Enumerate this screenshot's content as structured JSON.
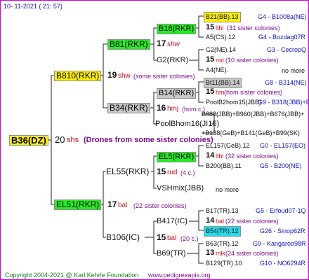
{
  "header": {
    "date": "10- 11-2021 ( 21: 57)"
  },
  "footer": {
    "copyright": "Copyright 2004-2021 @ Karl Kehrle Foundation",
    "website": "www.pedigreeapis.org"
  },
  "root": {
    "label": "B36(DZ)",
    "gen": "20",
    "breeder": "shs",
    "note": "(Drones from some sister colonies)"
  },
  "gen1": {
    "top": {
      "label": "B810(RKR)",
      "gen": "19",
      "breeder": "shw",
      "note": "(some sister colonies)"
    },
    "bottom": {
      "label": "EL51(RKR)",
      "gen": "17",
      "breeder": "bal",
      "note": "(22 sister colonies)"
    }
  },
  "gen2": {
    "b81": {
      "label": "B81(RKR)",
      "gen": "17",
      "breeder": "shw"
    },
    "b34": {
      "label": "B34(RKR)",
      "gen": "16",
      "breeder": "hmj",
      "note": "(hom c.)"
    },
    "el55": {
      "label": "EL55(RKR)",
      "gen": "15",
      "breeder": "rud",
      "note": "(4 c.)"
    },
    "b106": {
      "label": "B106(IC)",
      "gen": "15",
      "breeder": "bal",
      "note": "(20 c.)"
    }
  },
  "gen3": {
    "b18": {
      "label": "B18(RKR)"
    },
    "g2": {
      "label": "G2(RKR)"
    },
    "b14": {
      "label": "B14(RKR)"
    },
    "poolbhom": {
      "label": "PoolBhom16(JI15)"
    },
    "el5": {
      "label": "EL5(RKR)"
    },
    "vshmix": {
      "label": "VSHmix(JBB)",
      "more": "no more"
    },
    "b417": {
      "label": "B417(IC)"
    },
    "b69": {
      "label": "B69(TR)"
    }
  },
  "gen4": [
    {
      "key": "b21",
      "label": "B21(BB).13",
      "id": "G4 - B1008a(NE)"
    },
    {
      "key": "b21_note",
      "gen": "15",
      "breeder": "lthl",
      "note": "(31 sister colonies)"
    },
    {
      "key": "a5",
      "label": "A5(CS).12",
      "id": "G4 - Bozdag07R"
    },
    {
      "key": "g2ne",
      "label": "G2(NE).14",
      "id": "G3 - CecropQ"
    },
    {
      "key": "g2ne_note",
      "gen": "15",
      "breeder": "nst",
      "note": "(10 sister colonies)"
    },
    {
      "key": "a4",
      "label": "A4(NE).",
      "id": "no more"
    },
    {
      "key": "bt11",
      "label": "Bt11(BB).14",
      "id": "G8 - B314(NE)"
    },
    {
      "key": "bt11_note",
      "gen": "15",
      "breeder": "hm",
      "note": "(hom sister colonies)"
    },
    {
      "key": "poolb2",
      "label": "PoolB2hom15(JBB)",
      "id": "G9 - B318(JBB)+B88(JBB)+"
    },
    {
      "key": "b888",
      "label": "B888(JBB)+B960(JBB)+B676(JBB)+"
    },
    {
      "key": "b138",
      "label": "+B138(GeB)+B141(GeB)+B99(SK)"
    },
    {
      "key": "el157",
      "label": "EL157(GeB).12",
      "id": "G0 - EL157(EO)"
    },
    {
      "key": "el157_note",
      "gen": "14",
      "breeder": "lthl",
      "note": "(32 sister colonies)"
    },
    {
      "key": "b200",
      "label": "B200(BB).11",
      "id": "G5 - B200(NE)"
    },
    {
      "key": "b17",
      "label": "B17(TR).13",
      "id": "G5 - Erfoud07-1Q"
    },
    {
      "key": "b17_note",
      "gen": "14",
      "breeder": "bal",
      "note": "(22 sister colonies)"
    },
    {
      "key": "b54",
      "label": "B54(TR).12",
      "id": "G26 - Sinop62R"
    },
    {
      "key": "b63",
      "label": "B63(TR).12",
      "id": "G9 - Kangaroo98R"
    },
    {
      "key": "b63_note",
      "gen": "13",
      "breeder": "mlk",
      "note": "(24 sister colonies)"
    },
    {
      "key": "b129",
      "label": "B129(TR).10",
      "id": "G10 - NO6294R"
    }
  ]
}
